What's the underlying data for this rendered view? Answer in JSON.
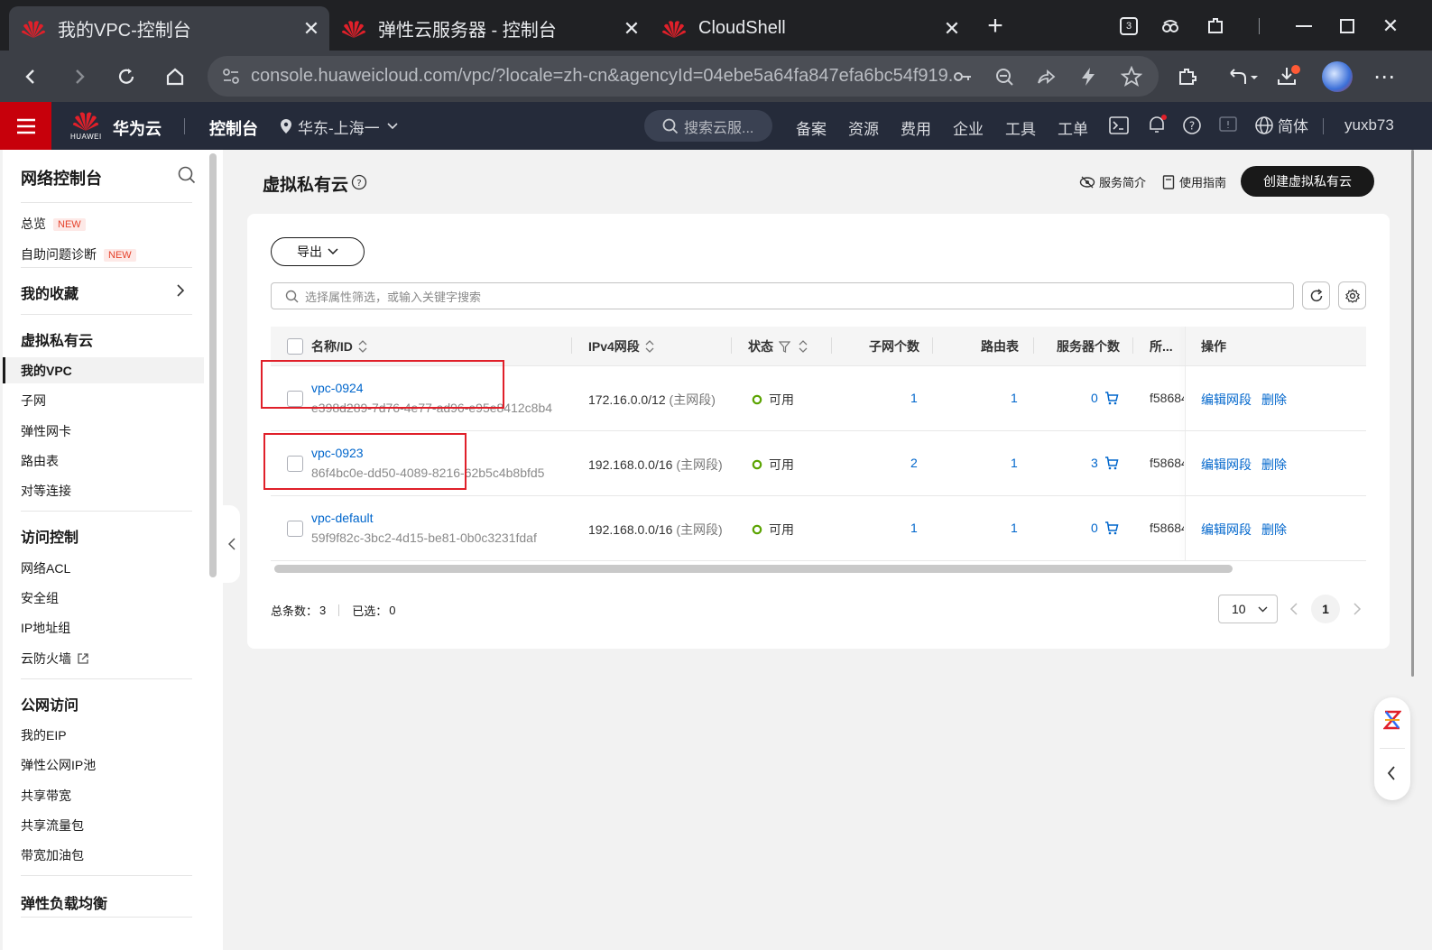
{
  "browser": {
    "tabs": [
      {
        "title": "我的VPC-控制台",
        "active": true
      },
      {
        "title": "弹性云服务器 - 控制台",
        "active": false
      },
      {
        "title": "CloudShell",
        "active": false
      }
    ],
    "tab_count_badge": "3",
    "url": "console.huaweicloud.com/vpc/?locale=zh-cn&agencyId=04ebe5a64fa847efa6bc54f919..."
  },
  "header": {
    "brand": "华为云",
    "logo_text": "HUAWEI",
    "console": "控制台",
    "region": "华东-上海一",
    "search_placeholder": "搜索云服...",
    "nav": [
      "备案",
      "资源",
      "费用",
      "企业",
      "工具",
      "工单"
    ],
    "language": "简体",
    "user": "yuxb73"
  },
  "sidebar": {
    "title": "网络控制台",
    "overview": "总览",
    "diagnosis": "自助问题诊断",
    "new_tag": "NEW",
    "favorites": "我的收藏",
    "sections": [
      {
        "title": "虚拟私有云",
        "items": [
          "我的VPC",
          "子网",
          "弹性网卡",
          "路由表",
          "对等连接"
        ]
      },
      {
        "title": "访问控制",
        "items": [
          "网络ACL",
          "安全组",
          "IP地址组",
          "云防火墙"
        ]
      },
      {
        "title": "公网访问",
        "items": [
          "我的EIP",
          "弹性公网IP池",
          "共享带宽",
          "共享流量包",
          "带宽加油包"
        ]
      },
      {
        "title": "弹性负载均衡",
        "items": []
      }
    ],
    "active_item": "我的VPC"
  },
  "page": {
    "title": "虚拟私有云",
    "service_intro": "服务简介",
    "guide": "使用指南",
    "create_button": "创建虚拟私有云",
    "export_button": "导出",
    "filter_placeholder": "选择属性筛选，或输入关键字搜索"
  },
  "table": {
    "columns": [
      "名称/ID",
      "IPv4网段",
      "状态",
      "子网个数",
      "路由表",
      "服务器个数",
      "所...",
      "操作"
    ],
    "rows": [
      {
        "name": "vpc-0924",
        "id": "e398d289-7d76-4e77-ad96-e95e8412c8b4",
        "ipv4": "172.16.0.0/12",
        "ipv4_note": "(主网段)",
        "status": "可用",
        "subnets": "1",
        "route_tables": "1",
        "servers": "0",
        "owner": "f58684",
        "actions": [
          "编辑网段",
          "删除"
        ],
        "highlighted": true
      },
      {
        "name": "vpc-0923",
        "id": "86f4bc0e-dd50-4089-8216-62b5c4b8bfd5",
        "ipv4": "192.168.0.0/16",
        "ipv4_note": "(主网段)",
        "status": "可用",
        "subnets": "2",
        "route_tables": "1",
        "servers": "3",
        "owner": "f58684",
        "actions": [
          "编辑网段",
          "删除"
        ],
        "highlighted": true
      },
      {
        "name": "vpc-default",
        "id": "59f9f82c-3bc2-4d15-be81-0b0c3231fdaf",
        "ipv4": "192.168.0.0/16",
        "ipv4_note": "(主网段)",
        "status": "可用",
        "subnets": "1",
        "route_tables": "1",
        "servers": "0",
        "owner": "f58684",
        "actions": [
          "编辑网段",
          "删除"
        ],
        "highlighted": false
      }
    ]
  },
  "footer": {
    "total_label": "总条数：",
    "total": "3",
    "selected_label": "已选：",
    "selected": "0",
    "page_size": "10",
    "current_page": "1"
  },
  "colors": {
    "brand_red": "#c7000b",
    "link": "#0066cc",
    "status_ok": "#5aa300",
    "annotation_red": "#e0202a"
  }
}
